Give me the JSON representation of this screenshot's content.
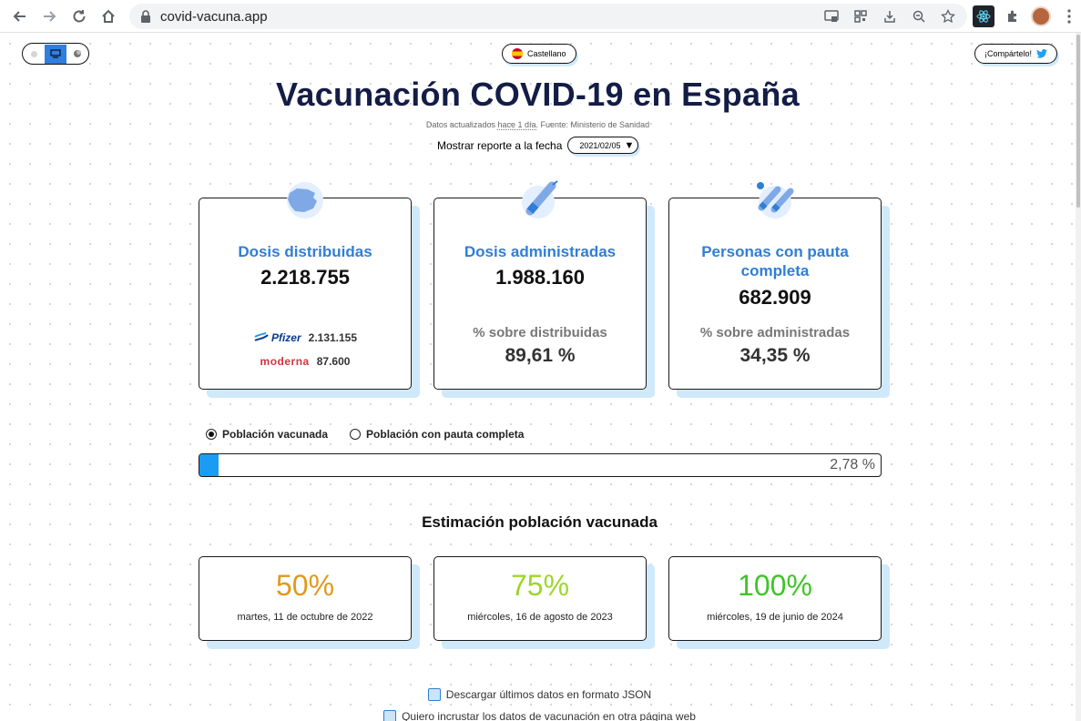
{
  "browser": {
    "url": "covid-vacuna.app"
  },
  "header": {
    "language": "Castellano",
    "share": "¡Compártelo!"
  },
  "title": "Vacunación COVID-19 en España",
  "updated": {
    "prefix": "Datos actualizados",
    "ago": "hace 1 día",
    "suffix": ". Fuente: Ministerio de Sanidad"
  },
  "report": {
    "label": "Mostrar reporte a la fecha",
    "date": "2021/02/05"
  },
  "cards": [
    {
      "label": "Dosis distribuidas",
      "value": "2.218.755",
      "brands": [
        {
          "name": "Pfizer",
          "value": "2.131.155"
        },
        {
          "name": "moderna",
          "value": "87.600"
        }
      ]
    },
    {
      "label": "Dosis administradas",
      "value": "1.988.160",
      "sub_label": "% sobre distribuidas",
      "sub_value": "89,61 %"
    },
    {
      "label": "Personas con pauta completa",
      "value": "682.909",
      "sub_label": "% sobre administradas",
      "sub_value": "34,35 %"
    }
  ],
  "population": {
    "options": [
      "Población vacunada",
      "Población con pauta completa"
    ],
    "selected": 0,
    "progress_label": "2,78 %",
    "progress_fraction": 0.0278
  },
  "estimation": {
    "title": "Estimación población vacunada",
    "items": [
      {
        "percent": "50%",
        "date": "martes, 11 de octubre de 2022",
        "color": "#e0991c"
      },
      {
        "percent": "75%",
        "date": "miércoles, 16 de agosto de 2023",
        "color": "#9dd62b"
      },
      {
        "percent": "100%",
        "date": "miércoles, 19 de junio de 2024",
        "color": "#3fc528"
      }
    ]
  },
  "links": {
    "download": "Descargar últimos datos en formato JSON",
    "embed": "Quiero incrustar los datos de vacunación en otra página web"
  },
  "colors": {
    "accent": "#2f7ed8",
    "shadow": "#cfe9fb",
    "progress": "#1a9cf4",
    "title": "#131d45"
  }
}
